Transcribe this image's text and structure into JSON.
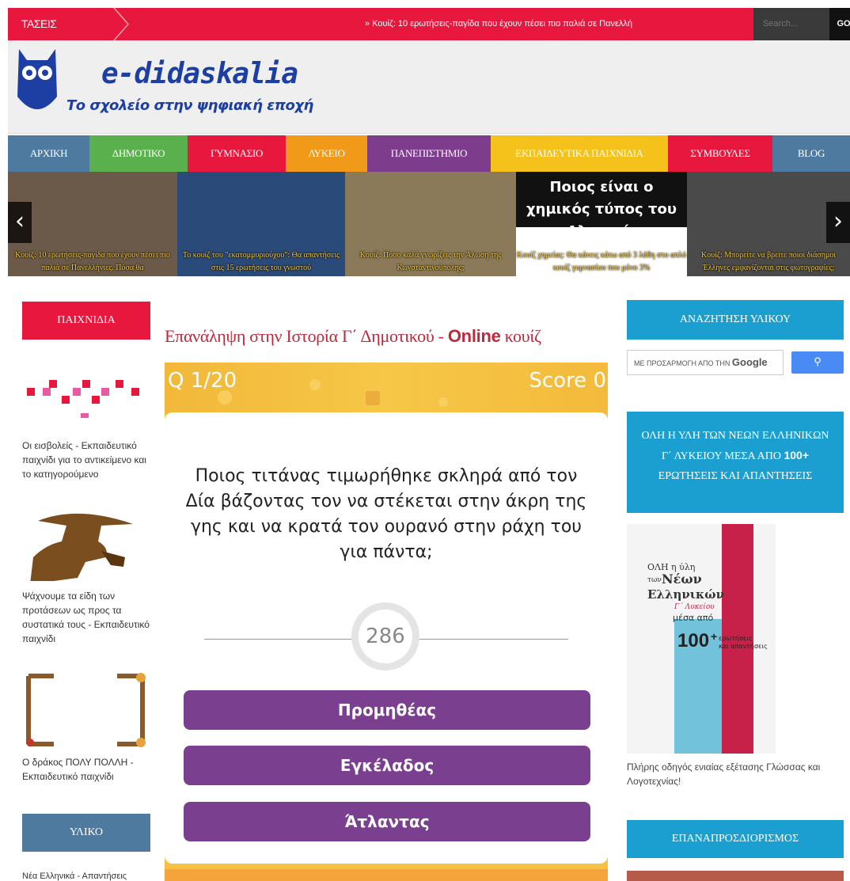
{
  "topbar": {
    "trending_label": "ΤΑΣΕΙΣ",
    "ticker": "» Κουίζ: 10 ερωτήσεις-παγίδα που έχουν πέσει πιο παλιά σε Πανελλή",
    "search_placeholder": "Search...",
    "go_label": "GO"
  },
  "header": {
    "logo_title": "e-didaskalia",
    "logo_subtitle": "Το σχολείο στην ψηφιακή εποχή"
  },
  "nav": [
    {
      "label": "ΑΡΧΙΚΗ",
      "color": "#4e7aa0",
      "width": 103
    },
    {
      "label": "ΔΗΜΟΤΙΚΟ",
      "color": "#59b04c",
      "width": 124
    },
    {
      "label": "ΓΥΜΝΑΣΙΟ",
      "color": "#e8173d",
      "width": 124
    },
    {
      "label": "ΛΥΚΕΙΟ",
      "color": "#f19a1a",
      "width": 103
    },
    {
      "label": "ΠΑΝΕΠΙΣΤΗΜΙΟ",
      "color": "#7d3c8c",
      "width": 156
    },
    {
      "label": "ΕΚΠΑΙΔΕΥΤΙΚΑ ΠΑΙΧΝΙΔΙΑ",
      "color": "#f5c11b",
      "width": 224
    },
    {
      "label": "ΣΥΜΒΟΥΛΕΣ",
      "color": "#e8173d",
      "width": 132
    },
    {
      "label": "BLOG",
      "color": "#4e7aa0",
      "width": 98
    }
  ],
  "slider": {
    "slides": [
      {
        "caption": "Κουίζ: 10 ερωτήσεις-παγίδα που έχουν πέσει πιο παλιά σε Πανελλήνιες. Πόσα θα",
        "color": "#6b5a4a"
      },
      {
        "caption": "Το κουίζ του \"εκατομμυριούχου\": Θα απαντήσεις στις 15 ερωτήσεις του γνωστού",
        "color": "#2a4a7a"
      },
      {
        "caption": "Κουίζ: Πόσο καλά γνωρίζεις την Άλωση της Κωνσταντινούπολης;",
        "color": "#8a7a5a"
      },
      {
        "caption": "Κουίζ χημείας: Θα κάνεις κάτω από 3 λάθη στο απλό κουίζ γυμνασίου που μόνο 3%",
        "color": "#1a1a1a",
        "headline": "Ποιος είναι ο χημικός τύπος του Αλατιού;"
      },
      {
        "caption": "Κουίζ: Μπορείτε να βρείτε ποιοι διάσημοι Έλληνες εμφανίζονται στις φωτογραφίες;",
        "color": "#4a4a4a"
      }
    ]
  },
  "left_sidebar": {
    "games_title": "ΠΑΙΧΝΙΔΙΑ",
    "items": [
      "Οι εισβολείς - Εκπαιδευτικό παιχνίδι για το αντικείμενο και το κατηγορούμενο",
      "Ψάχνουμε τα είδη των προτάσεων ως προς τα συστατικά τους - Εκπαιδευτικό παιχνίδι",
      "Ο δράκος ΠΟΛΥ ΠΟΛΛΗ - Εκπαιδευτικό παιχνίδι"
    ],
    "material_title": "ΥΛΙΚΟ",
    "material_first": "Νέα Ελληνικά - Απαντήσεις"
  },
  "main": {
    "title_pre": "Επανάληψη στην Ιστορία Γ΄ Δημοτικού - ",
    "title_en": "Online",
    "title_post": " κουίζ",
    "question_counter": "Q 1/20",
    "score_label": "Score 0",
    "question": "Ποιος τιτάνας τιμωρήθηκε σκληρά από τον Δία βάζοντας τον να στέκεται στην άκρη της γης και να κρατά τον ουρανό στην ράχη του για πάντα;",
    "timer": "286",
    "answers": [
      "Προμηθέας",
      "Εγκέλαδος",
      "Άτλαντας"
    ]
  },
  "right_sidebar": {
    "search_title": "ΑΝΑΖΗΤΗΣΗ ΥΛΙΚΟΥ",
    "google_prefix": "ΜΕ ΠΡΟΣΑΡΜΟΓΗ ΑΠΟ ΤΗΝ",
    "google_brand": "Google",
    "promo_title_1": "ΟΛΗ Η ΥΛΗ ΤΩΝ ΝΕΩΝ ΕΛΛΗΝΙΚΩΝ Γ΄ ΛΥΚΕΙΟΥ ΜΕΣΑ ΑΠΟ ",
    "promo_title_num": "100+",
    "promo_title_2": " ΕΡΩΤΗΣΕΙΣ ΚΑΙ ΑΠΑΝΤΗΣΕΙΣ",
    "book": {
      "line1": "ΟΛΗ η ύλη",
      "line2": "των",
      "line3": "Νέων",
      "line4": "Ελληνικών",
      "line5": "Γ΄ Λυκείου",
      "line6": "μέσα από",
      "num": "100",
      "plus": "+",
      "tail1": "ερωτήσεις",
      "tail2": "και απαντήσεις"
    },
    "book_caption": "Πλήρης οδηγός ενιαίας εξέτασης Γλώσσας και Λογοτεχνίας!",
    "redefine_title": "ΕΠΑΝΑΠΡΟΣΔΙΟΡΙΣΜΟΣ"
  }
}
